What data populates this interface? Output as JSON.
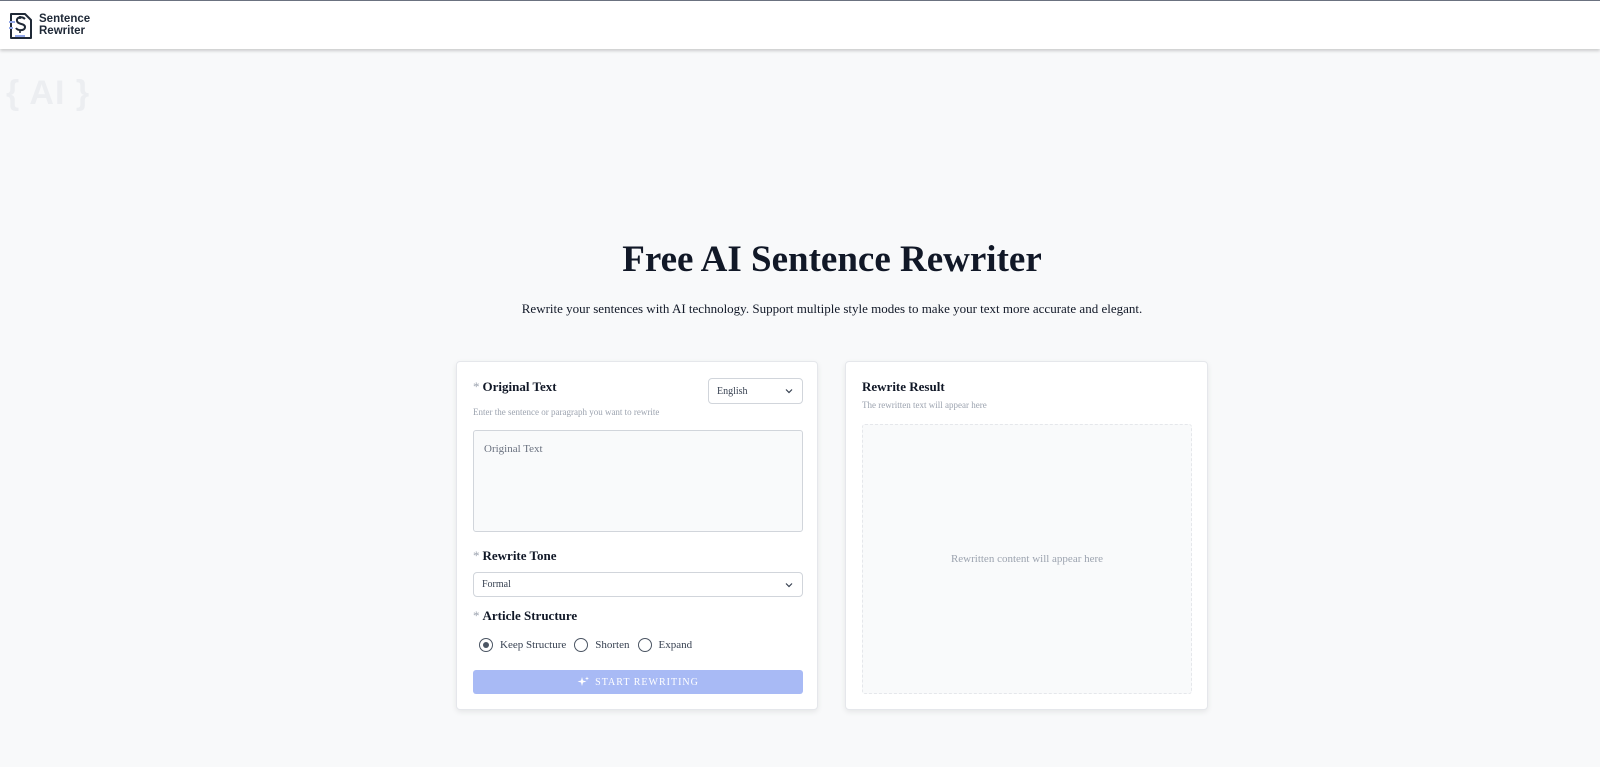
{
  "header": {
    "logo_line1": "Sentence",
    "logo_line2": "Rewriter",
    "logo_icon": "document-s-icon"
  },
  "watermark": "{ AI }",
  "hero": {
    "title": "Free AI Sentence Rewriter",
    "subtitle": "Rewrite your sentences with AI technology. Support multiple style modes to make your text more accurate and elegant."
  },
  "input_panel": {
    "required_mark": "*",
    "original_label": "Original Text",
    "original_hint": "Enter the sentence or paragraph you want to rewrite",
    "original_placeholder": "Original Text",
    "original_value": "",
    "language_selected": "English",
    "tone_label": "Rewrite Tone",
    "tone_selected": "Formal",
    "structure_label": "Article Structure",
    "structure_options": [
      {
        "label": "Keep Structure",
        "selected": true
      },
      {
        "label": "Shorten",
        "selected": false
      },
      {
        "label": "Expand",
        "selected": false
      }
    ],
    "start_button": "START REWRITING",
    "start_icon": "sparkle-icon"
  },
  "result_panel": {
    "title": "Rewrite Result",
    "hint": "The rewritten text will appear here",
    "placeholder": "Rewritten content will appear here"
  },
  "colors": {
    "accent_button": "#a8baf5",
    "background": "#f8f9fa",
    "text_primary": "#111827",
    "text_muted": "#9ca3af"
  }
}
